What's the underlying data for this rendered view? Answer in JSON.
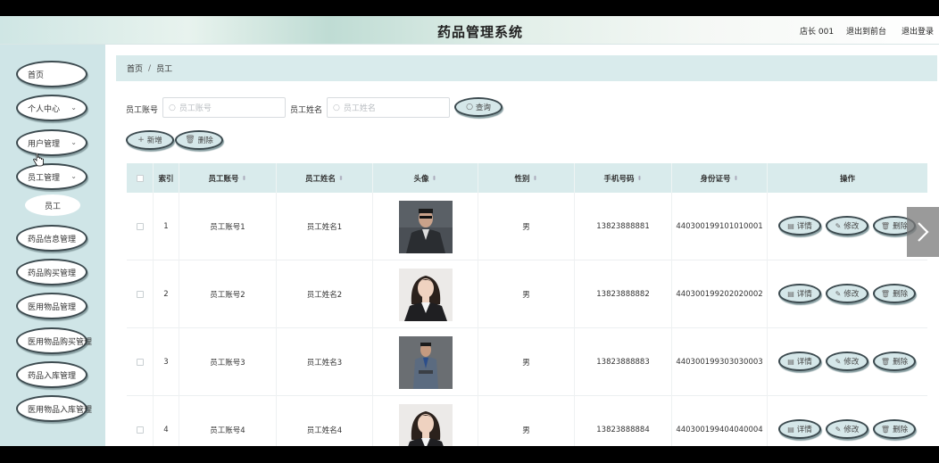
{
  "header": {
    "title": "药品管理系统",
    "user": "店长 001",
    "back_to_front": "退出到前台",
    "logout": "退出登录"
  },
  "sidebar": {
    "items": [
      {
        "label": "首页",
        "icon": ""
      },
      {
        "label": "个人中心",
        "icon": "chevron-down-icon"
      },
      {
        "label": "用户管理",
        "icon": "chevron-down-icon"
      },
      {
        "label": "员工管理",
        "icon": "chevron-down-icon"
      },
      {
        "label": "药品信息管理",
        "icon": ""
      },
      {
        "label": "药品购买管理",
        "icon": ""
      },
      {
        "label": "医用物品管理",
        "icon": ""
      },
      {
        "label": "医用物品购买管理",
        "icon": ""
      },
      {
        "label": "药品入库管理",
        "icon": ""
      },
      {
        "label": "医用物品入库管理",
        "icon": ""
      }
    ],
    "sub_item": "员工"
  },
  "breadcrumb": {
    "home": "首页",
    "separator": "/",
    "current": "员工"
  },
  "search": {
    "account_label": "员工账号",
    "account_placeholder": "员工账号",
    "name_label": "员工姓名",
    "name_placeholder": "员工姓名",
    "query_button": "查询"
  },
  "actions": {
    "add": "新增",
    "delete": "删除"
  },
  "table": {
    "headers": [
      "索引",
      "员工账号",
      "员工姓名",
      "头像",
      "性别",
      "手机号码",
      "身份证号",
      "操作"
    ],
    "rows": [
      {
        "index": "1",
        "account": "员工账号1",
        "name": "员工姓名1",
        "gender": "男",
        "phone": "13823888881",
        "id_number": "440300199101010001"
      },
      {
        "index": "2",
        "account": "员工账号2",
        "name": "员工姓名2",
        "gender": "男",
        "phone": "13823888882",
        "id_number": "440300199202020002"
      },
      {
        "index": "3",
        "account": "员工账号3",
        "name": "员工姓名3",
        "gender": "男",
        "phone": "13823888883",
        "id_number": "440300199303030003"
      },
      {
        "index": "4",
        "account": "员工账号4",
        "name": "员工姓名4",
        "gender": "男",
        "phone": "13823888884",
        "id_number": "440300199404040004"
      }
    ],
    "row_actions": {
      "detail": "详情",
      "edit": "修改",
      "delete": "删除"
    }
  },
  "colors": {
    "sidebar_bg": "#cfe5e7",
    "header_row_bg": "#d9ebec",
    "button_bg": "#d5e7e9",
    "button_border": "#3c4a4f"
  }
}
